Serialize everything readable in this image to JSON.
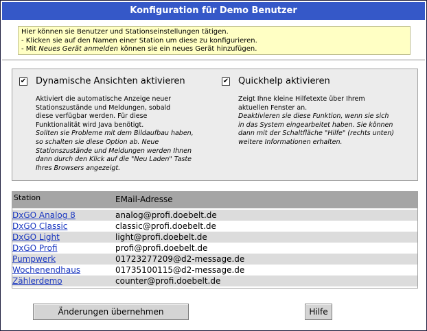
{
  "title": "Konfiguration für Demo Benutzer",
  "info": {
    "line1": "Hier können sie Benutzer und Stationseinstellungen tätigen.",
    "line2": "- Klicken sie auf den Namen einer Station um diese zu konfigurieren.",
    "line3_pre": "- Mit ",
    "line3_em": "Neues Gerät anmelden",
    "line3_post": " können sie ein neues Gerät hinzufügen."
  },
  "options": {
    "dynamic": {
      "label": "Dynamische Ansichten aktivieren",
      "checked": true,
      "checkmark": "✔",
      "desc_normal": [
        "Aktiviert die automatische Anzeige neuer",
        "Stationszustände und Meldungen, sobald",
        "diese verfügbar werden. Für diese",
        "Funktionalität wird Java benötigt."
      ],
      "desc_italic": [
        "Sollten sie Probleme mit dem Bildaufbau haben,",
        "so schalten sie diese Option ab. Neue",
        "Stationszustände und Meldungen werden Ihnen",
        "dann durch den Klick auf die \"Neu Laden\" Taste",
        "Ihres Browsers angezeigt."
      ]
    },
    "quickhelp": {
      "label": "Quickhelp aktivieren",
      "checked": true,
      "checkmark": "✔",
      "desc_normal": [
        "Zeigt Ihne kleine Hilfetexte über Ihrem",
        "aktuellen Fenster an."
      ],
      "desc_italic": [
        "Deaktivieren sie diese Funktion, wenn sie sich",
        "in das System eingearbeitet haben. Sie können",
        "dann mit der Schaltfläche \"Hilfe\" (rechts unten)",
        "weitere Informationen erhalten."
      ]
    }
  },
  "table": {
    "headers": [
      "Station",
      "EMail-Adresse"
    ],
    "rows": [
      {
        "station": "DxGO Analog 8",
        "email": "analog@profi.doebelt.de"
      },
      {
        "station": "DxGO Classic",
        "email": "classic@profi.doebelt.de"
      },
      {
        "station": "DxGO Light",
        "email": "light@profi.doebelt.de"
      },
      {
        "station": "DxGO Profi",
        "email": "profi@profi.doebelt.de"
      },
      {
        "station": "Pumpwerk",
        "email": "01723277209@d2-message.de"
      },
      {
        "station": "Wochenendhaus",
        "email": "01735100115@d2-message.de"
      },
      {
        "station": "Zählerdemo",
        "email": "counter@profi.doebelt.de"
      }
    ]
  },
  "buttons": {
    "apply": "Änderungen übernehmen",
    "help": "Hilfe"
  },
  "colors": {
    "titlebar": "#3558c8",
    "info_bg": "#ffffc4",
    "link": "#1a37c0"
  }
}
